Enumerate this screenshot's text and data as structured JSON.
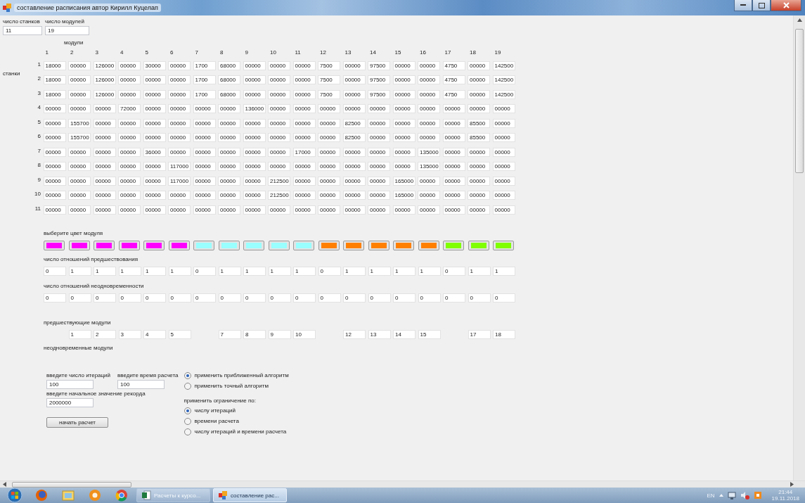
{
  "window": {
    "title": "составление расписания автор Кирилл Куцелап"
  },
  "counts": [
    {
      "label": "число станков",
      "value": "11"
    },
    {
      "label": "число модулей",
      "value": "19"
    }
  ],
  "matrix": {
    "column_caption": "модули",
    "row_caption": "станки",
    "columns": [
      "1",
      "2",
      "3",
      "4",
      "5",
      "6",
      "7",
      "8",
      "9",
      "10",
      "11",
      "12",
      "13",
      "14",
      "15",
      "16",
      "17",
      "18",
      "19"
    ],
    "rows": [
      {
        "label": "1",
        "cells": [
          "18000",
          "00000",
          "126000",
          "00000",
          "30000",
          "00000",
          "1700",
          "68000",
          "00000",
          "00000",
          "00000",
          "7500",
          "00000",
          "97500",
          "00000",
          "00000",
          "4750",
          "00000",
          "142500"
        ]
      },
      {
        "label": "2",
        "cells": [
          "18000",
          "00000",
          "126000",
          "00000",
          "00000",
          "00000",
          "1700",
          "68000",
          "00000",
          "00000",
          "00000",
          "7500",
          "00000",
          "97500",
          "00000",
          "00000",
          "4750",
          "00000",
          "142500"
        ]
      },
      {
        "label": "3",
        "cells": [
          "18000",
          "00000",
          "126000",
          "00000",
          "00000",
          "00000",
          "1700",
          "68000",
          "00000",
          "00000",
          "00000",
          "7500",
          "00000",
          "97500",
          "00000",
          "00000",
          "4750",
          "00000",
          "142500"
        ]
      },
      {
        "label": "4",
        "cells": [
          "00000",
          "00000",
          "00000",
          "72000",
          "00000",
          "00000",
          "00000",
          "00000",
          "136000",
          "00000",
          "00000",
          "00000",
          "00000",
          "00000",
          "00000",
          "00000",
          "00000",
          "00000",
          "00000"
        ]
      },
      {
        "label": "5",
        "cells": [
          "00000",
          "155700",
          "00000",
          "00000",
          "00000",
          "00000",
          "00000",
          "00000",
          "00000",
          "00000",
          "00000",
          "00000",
          "82500",
          "00000",
          "00000",
          "00000",
          "00000",
          "85500",
          "00000"
        ]
      },
      {
        "label": "6",
        "cells": [
          "00000",
          "155700",
          "00000",
          "00000",
          "00000",
          "00000",
          "00000",
          "00000",
          "00000",
          "00000",
          "00000",
          "00000",
          "82500",
          "00000",
          "00000",
          "00000",
          "00000",
          "85500",
          "00000"
        ]
      },
      {
        "label": "7",
        "cells": [
          "00000",
          "00000",
          "00000",
          "00000",
          "36000",
          "00000",
          "00000",
          "00000",
          "00000",
          "00000",
          "17000",
          "00000",
          "00000",
          "00000",
          "00000",
          "135000",
          "00000",
          "00000",
          "00000"
        ]
      },
      {
        "label": "8",
        "cells": [
          "00000",
          "00000",
          "00000",
          "00000",
          "00000",
          "117000",
          "00000",
          "00000",
          "00000",
          "00000",
          "00000",
          "00000",
          "00000",
          "00000",
          "00000",
          "135000",
          "00000",
          "00000",
          "00000"
        ]
      },
      {
        "label": "9",
        "cells": [
          "00000",
          "00000",
          "00000",
          "00000",
          "00000",
          "117000",
          "00000",
          "00000",
          "00000",
          "212500",
          "00000",
          "00000",
          "00000",
          "00000",
          "165000",
          "00000",
          "00000",
          "00000",
          "00000"
        ]
      },
      {
        "label": "10",
        "cells": [
          "00000",
          "00000",
          "00000",
          "00000",
          "00000",
          "00000",
          "00000",
          "00000",
          "00000",
          "212500",
          "00000",
          "00000",
          "00000",
          "00000",
          "165000",
          "00000",
          "00000",
          "00000",
          "00000"
        ]
      },
      {
        "label": "11",
        "cells": [
          "00000",
          "00000",
          "00000",
          "00000",
          "00000",
          "00000",
          "00000",
          "00000",
          "00000",
          "00000",
          "00000",
          "00000",
          "00000",
          "00000",
          "00000",
          "00000",
          "00000",
          "00000",
          "00000"
        ]
      }
    ]
  },
  "colors": {
    "label": "выберите цвет модуля",
    "swatches": [
      {
        "color": "#ff00ff"
      },
      {
        "color": "#ff00ff"
      },
      {
        "color": "#ff00ff"
      },
      {
        "color": "#ff00ff"
      },
      {
        "color": "#ff00ff"
      },
      {
        "color": "#ff00ff"
      },
      {
        "color": "#99ffff"
      },
      {
        "color": "#99ffff"
      },
      {
        "color": "#99ffff"
      },
      {
        "color": "#99ffff"
      },
      {
        "color": "#99ffff"
      },
      {
        "color": "#ff8000"
      },
      {
        "color": "#ff8000"
      },
      {
        "color": "#ff8000"
      },
      {
        "color": "#ff8000"
      },
      {
        "color": "#ff8000"
      },
      {
        "color": "#80ff00"
      },
      {
        "color": "#80ff00"
      },
      {
        "color": "#80ff00"
      }
    ]
  },
  "precedence_counts": {
    "label": "число отношений предшествования",
    "values": [
      "0",
      "1",
      "1",
      "1",
      "1",
      "1",
      "0",
      "1",
      "1",
      "1",
      "1",
      "0",
      "1",
      "1",
      "1",
      "1",
      "0",
      "1",
      "1"
    ]
  },
  "nonsimultaneity_counts": {
    "label": "число отношений неодновременности",
    "values": [
      "0",
      "0",
      "0",
      "0",
      "0",
      "0",
      "0",
      "0",
      "0",
      "0",
      "0",
      "0",
      "0",
      "0",
      "0",
      "0",
      "0",
      "0",
      "0"
    ]
  },
  "predecessors": {
    "label": "предшествующие модули",
    "values": [
      {
        "kind": "blank"
      },
      {
        "kind": "module",
        "value": "1"
      },
      {
        "kind": "module",
        "value": "2"
      },
      {
        "kind": "module",
        "value": "3"
      },
      {
        "kind": "module",
        "value": "4"
      },
      {
        "kind": "module",
        "value": "5"
      },
      {
        "kind": "blank"
      },
      {
        "kind": "module",
        "value": "7"
      },
      {
        "kind": "module",
        "value": "8"
      },
      {
        "kind": "module",
        "value": "9"
      },
      {
        "kind": "module",
        "value": "10"
      },
      {
        "kind": "blank"
      },
      {
        "kind": "module",
        "value": "12"
      },
      {
        "kind": "module",
        "value": "13"
      },
      {
        "kind": "module",
        "value": "14"
      },
      {
        "kind": "module",
        "value": "15"
      },
      {
        "kind": "blank"
      },
      {
        "kind": "module",
        "value": "17"
      },
      {
        "kind": "module",
        "value": "18"
      }
    ]
  },
  "nonsimultaneous_modules": {
    "label": "неодновременные модули"
  },
  "settings": {
    "iterations": {
      "label": "введите число итераций",
      "value": "100"
    },
    "time": {
      "label": "введите время расчета",
      "value": "100"
    },
    "record": {
      "label": "введите начальное значение рекорда",
      "value": "2000000"
    },
    "start_button": "начать расчет"
  },
  "algorithm": [
    {
      "label": "применить приближенный алгоритм",
      "selected": true
    },
    {
      "label": "применить точный алгоритм",
      "selected": false
    }
  ],
  "limit": {
    "label": "применить ограничение по:",
    "options": [
      {
        "label": "числу итераций",
        "selected": true
      },
      {
        "label": "времени расчета",
        "selected": false
      },
      {
        "label": "числу итераций и времени расчета",
        "selected": false
      }
    ]
  },
  "taskbar": {
    "tasks": [
      {
        "kind": "spreadsheet",
        "label": "Расчеты к курсо...",
        "selected": false
      },
      {
        "kind": "app",
        "label": "составление рас...",
        "selected": true
      }
    ],
    "tray": {
      "language": "EN",
      "time": "21:44",
      "date": "19.11.2018"
    }
  }
}
